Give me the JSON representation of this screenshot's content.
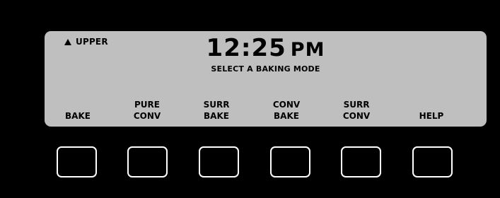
{
  "display": {
    "zone_label": "UPPER",
    "zone_icon": "up-triangle-icon",
    "time": "12:25",
    "ampm": "PM",
    "prompt": "SELECT A BAKING MODE"
  },
  "softkeys": [
    {
      "line1": "",
      "line2": "BAKE"
    },
    {
      "line1": "PURE",
      "line2": "CONV"
    },
    {
      "line1": "SURR",
      "line2": "BAKE"
    },
    {
      "line1": "CONV",
      "line2": "BAKE"
    },
    {
      "line1": "SURR",
      "line2": "CONV"
    },
    {
      "line1": "",
      "line2": "HELP"
    }
  ],
  "colors": {
    "background": "#000000",
    "lcd": "#bfbfbf",
    "key_border": "#ffffff"
  }
}
